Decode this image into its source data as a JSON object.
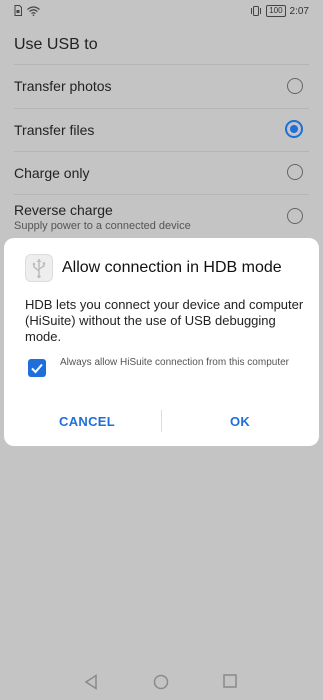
{
  "status_bar": {
    "time": "2:07",
    "battery_level": "100",
    "left_icons": [
      "sim-icon",
      "wifi-icon"
    ],
    "right_icons": [
      "vibrate-icon",
      "battery-icon"
    ]
  },
  "page": {
    "title": "Use USB to",
    "options": [
      {
        "label": "Transfer photos",
        "selected": false
      },
      {
        "label": "Transfer files",
        "selected": true
      },
      {
        "label": "Charge only",
        "selected": false
      },
      {
        "label": "Reverse charge",
        "subtitle": "Supply power to a connected device",
        "selected": false
      }
    ]
  },
  "dialog": {
    "icon": "usb-icon",
    "title": "Allow connection in HDB mode",
    "body": "HDB lets you connect your device and computer (HiSuite) without the use of USB debugging mode.",
    "checkbox_label": "Always allow HiSuite connection from this computer",
    "checkbox_checked": true,
    "cancel_label": "CANCEL",
    "ok_label": "OK"
  },
  "navigation": {
    "buttons": [
      "back-icon",
      "home-icon",
      "recents-icon"
    ]
  },
  "colors": {
    "accent": "#1e6fd9",
    "dimmed_background": "#c4c4c4",
    "dialog_background": "#ffffff"
  }
}
